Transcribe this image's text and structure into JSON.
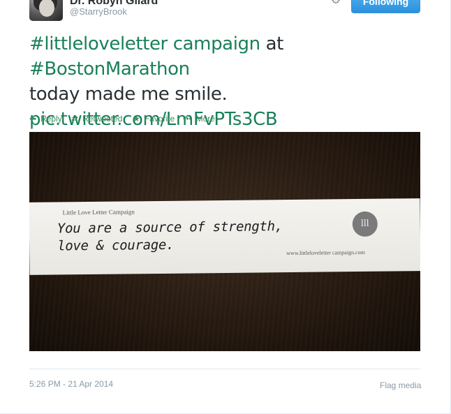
{
  "tweet": {
    "author": {
      "full_name": "Dr. Robyn Gilard",
      "username": "@StarryBrook"
    },
    "follow_button": "Following",
    "text": {
      "hashtag1": "#littleloveletter campaign",
      "mid": " at ",
      "hashtag2": "#BostonMarathon",
      "line2": "today made me smile.",
      "link": "pic.twitter.com/LmFvPTs3CB"
    },
    "actions": {
      "reply": "Reply",
      "retweet": "Retweeted",
      "favorite": "Favorite",
      "more": "More"
    },
    "media": {
      "strip_title": "Little Love Letter Campaign",
      "handwriting_line1": "You are a source of strength,",
      "handwriting_line2": "love & courage.",
      "logo_text": "lll",
      "url": "www.littleloveletter campaign.com"
    },
    "timestamp": "5:26 PM - 21 Apr 2014",
    "flag_media": "Flag media"
  },
  "colors": {
    "link": "#1a8059",
    "action": "#3b8c5c",
    "follow_button": "#2a92de",
    "muted": "#8899a6"
  },
  "icons": {
    "reply": "reply-arrow-icon",
    "retweet": "retweet-icon",
    "favorite": "star-icon",
    "more": "ellipsis-icon",
    "settings": "gear-icon"
  }
}
